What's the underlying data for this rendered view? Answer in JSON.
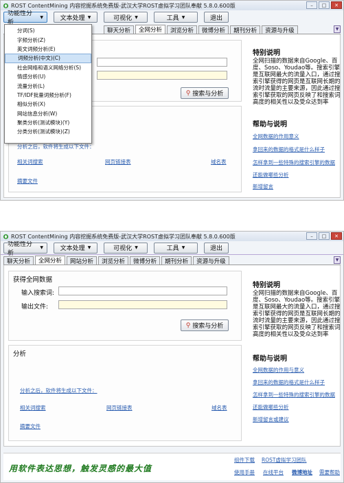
{
  "window": {
    "title": "ROST ContentMining 内容挖掘系统免费版-武汉大学ROST虚拟学习团队奉献  5.8.0.600版"
  },
  "menubar": {
    "items": [
      "功能性分析",
      "文本处理",
      "可视化",
      "工具"
    ],
    "exit_label": "退出"
  },
  "tabs1": [
    "聊天分析",
    "全网分析",
    "浏览分析",
    "微博分析",
    "期刊分析",
    "资源与升级"
  ],
  "tabs2": [
    "聊天分析",
    "全网分析",
    "网站分析",
    "浏览分析",
    "微博分析",
    "期刊分析",
    "资源与升级"
  ],
  "dropdown": {
    "items": [
      "分词(S)",
      "字频分析(Z)",
      "英文词频分析(E)",
      "词频分析(中文)(C)",
      "社会网络和语义网络分析(S)",
      "情感分析(U)",
      "流量分析(L)",
      "TF/IDF批量词频分析(F)",
      "相似分析(X)",
      "网站信息分析(W)",
      "聚类分析(测试模块)(Y)",
      "分类分析(测试模块)(Z)"
    ],
    "highlighted_index": 3
  },
  "collect": {
    "title": "获得全网数据",
    "keyword_label": "输入搜索词:",
    "output_label": "输出文件:",
    "keyword_value": "",
    "output_value": "",
    "search_button": "搜索与分析"
  },
  "analysis": {
    "title": "分析",
    "hint": "分析之后，软件将生成以下文件：",
    "links": [
      "相关词搜索",
      "网页链接表",
      "域名表",
      "摘要文件"
    ]
  },
  "sidebar": {
    "intro_title": "特别说明",
    "intro_text": "全网扫描的数据来自Google、百度、Soso、Youdao等。搜索引擎是互联网最大的流量入口，通过搜索引擎获得的网页是互联网长期的流时流量的主要来源，因此通过搜索引擎获取的网页反映了和搜索词高度的相关性以及受众达到率",
    "help_title": "帮助与说明",
    "help_links": [
      "全网数据的作用与意义",
      "拿回来的数据的格式是什么样子",
      "怎样拿到一些特殊的搜索引擎的数据",
      "还能做哪些分析",
      "新增留言或建议"
    ],
    "help_links_top": [
      "全网数据的作用意义",
      "拿回来的数据的格式是什么样子",
      "怎样拿到一些特殊的搜索引擎的数据",
      "还能做哪些分析",
      "新增留言"
    ]
  },
  "footer": {
    "slogan": "用软件表达思想，触发灵感的最大值",
    "links_row1": [
      "组件下载",
      "ROST虚拟学习团队"
    ],
    "links_row2": [
      "使用手册",
      "在线平台",
      "微博地址",
      "需要帮助"
    ]
  }
}
